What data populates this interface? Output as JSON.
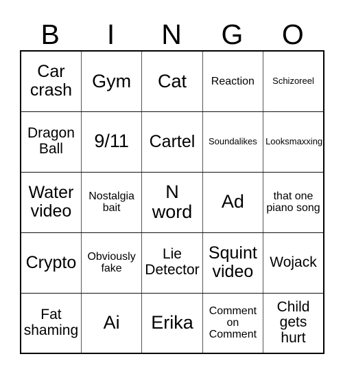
{
  "card": {
    "header": {
      "letters": [
        "B",
        "I",
        "N",
        "G",
        "O"
      ]
    },
    "rows": [
      [
        {
          "text": "Car crash",
          "size": "sz-lg"
        },
        {
          "text": "Gym",
          "size": "sz-xl"
        },
        {
          "text": "Cat",
          "size": "sz-xl"
        },
        {
          "text": "Reaction",
          "size": "sz-sm"
        },
        {
          "text": "Schizoreel",
          "size": "sz-xs"
        }
      ],
      [
        {
          "text": "Dragon Ball",
          "size": "sz-md"
        },
        {
          "text": "9/11",
          "size": "sz-xl"
        },
        {
          "text": "Cartel",
          "size": "sz-lg"
        },
        {
          "text": "Soundalikes",
          "size": "sz-xs"
        },
        {
          "text": "Looksmaxxing",
          "size": "sz-xs"
        }
      ],
      [
        {
          "text": "Water video",
          "size": "sz-lg"
        },
        {
          "text": "Nostalgia bait",
          "size": "sz-sm"
        },
        {
          "text": "N word",
          "size": "sz-xl"
        },
        {
          "text": "Ad",
          "size": "sz-xl"
        },
        {
          "text": "that one piano song",
          "size": "sz-sm"
        }
      ],
      [
        {
          "text": "Crypto",
          "size": "sz-lg"
        },
        {
          "text": "Obviously fake",
          "size": "sz-sm"
        },
        {
          "text": "Lie Detector",
          "size": "sz-md"
        },
        {
          "text": "Squint video",
          "size": "sz-lg"
        },
        {
          "text": "Wojack",
          "size": "sz-md"
        }
      ],
      [
        {
          "text": "Fat shaming",
          "size": "sz-md"
        },
        {
          "text": "Ai",
          "size": "sz-xl"
        },
        {
          "text": "Erika",
          "size": "sz-xl"
        },
        {
          "text": "Comment on Comment",
          "size": "sz-sm"
        },
        {
          "text": "Child gets hurt",
          "size": "sz-md"
        }
      ]
    ]
  },
  "colors": {
    "background": "#ffffff",
    "text": "#000000",
    "grid_line": "#555555",
    "grid_border": "#000000"
  }
}
